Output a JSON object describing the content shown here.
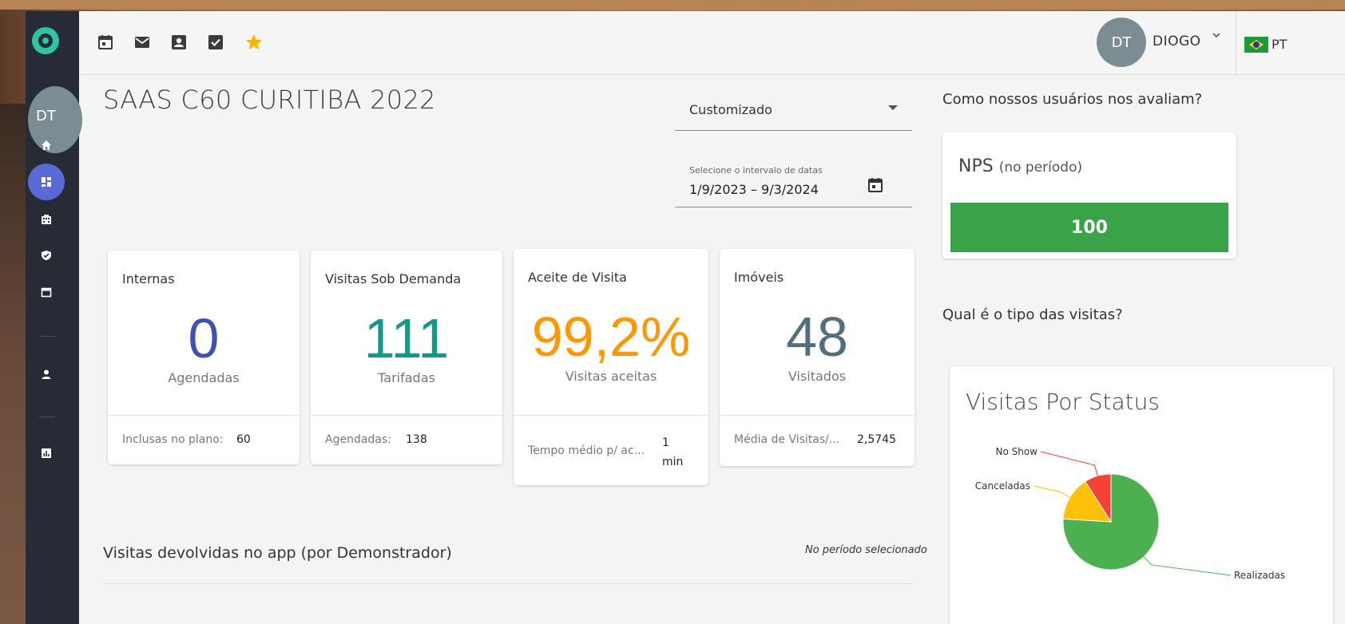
{
  "sidebar": {
    "avatar_initials": "DT",
    "items": [
      "home-icon",
      "dashboard-icon",
      "building-icon",
      "shield-check-icon",
      "calendar-icon",
      "person-icon",
      "report-icon"
    ]
  },
  "topbar": {
    "icons": [
      "calendar-icon",
      "mail-icon",
      "contact-icon",
      "checkbox-icon",
      "star-icon"
    ],
    "user_initials": "DT",
    "user_name": "DIOGO",
    "caret": "⌄",
    "language": "PT"
  },
  "main": {
    "title": "SAAS C60 CURITIBA 2022",
    "period_select": "Customizado",
    "date_range_label": "Selecione o intervalo de datas",
    "date_range_value": "1/9/2023 – 9/3/2024",
    "cards": [
      {
        "title": "Internas",
        "value": "0",
        "subtitle": "Agendadas",
        "foot_label": "Inclusas no plano:",
        "foot_value": "60",
        "color": "#3f51b5"
      },
      {
        "title": "Visitas Sob Demanda",
        "value": "111",
        "subtitle": "Tarifadas",
        "foot_label": "Agendadas:",
        "foot_value": "138",
        "color": "#11998a"
      },
      {
        "title": "Aceite de Visita",
        "value": "99,2%",
        "subtitle": "Visitas aceitas",
        "foot_label": "Tempo médio p/ ac...",
        "foot_value_line1": "1",
        "foot_value_line2": "min",
        "color": "#ff9800"
      },
      {
        "title": "Imóveis",
        "value": "48",
        "subtitle": "Visitados",
        "foot_label": "Média de Visitas/...",
        "foot_value": "2,5745",
        "color": "#546e7a"
      }
    ],
    "section_title": "Visitas devolvidas no app (por Demonstrador)",
    "section_note": "No período selecionado"
  },
  "right": {
    "nps_question": "Como nossos usuários nos avaliam?",
    "nps_label": "NPS",
    "nps_period": "(no período)",
    "nps_value": "100",
    "nps_color": "#3aa34a",
    "visits_question": "Qual é o tipo das visitas?"
  },
  "chart_data": {
    "type": "pie",
    "title": "Visitas Por Status",
    "categories": [
      "Realizadas",
      "Canceladas",
      "No Show"
    ],
    "values": [
      76,
      15,
      9
    ],
    "colors": [
      "#4caf50",
      "#ffc107",
      "#f44336"
    ]
  }
}
